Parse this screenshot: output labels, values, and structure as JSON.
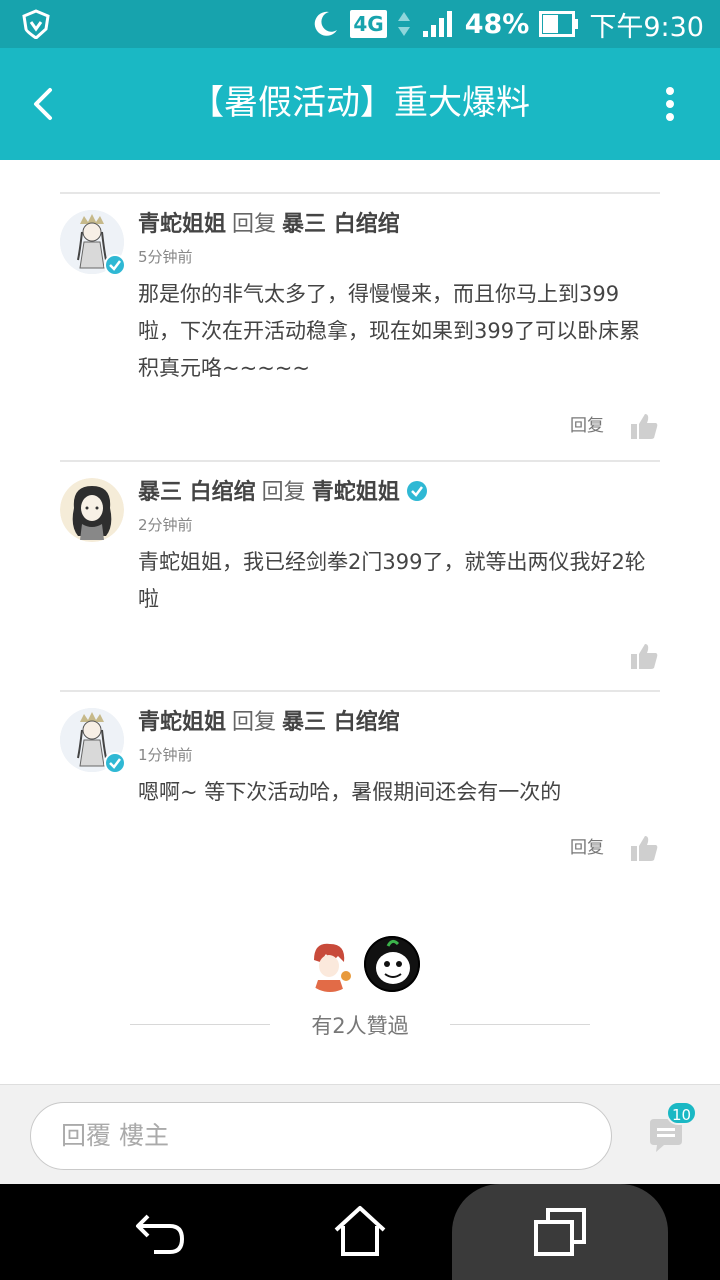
{
  "status_bar": {
    "network": "4G",
    "battery_pct": "48%",
    "time": "下午9:30"
  },
  "header": {
    "title": "【暑假活动】重大爆料"
  },
  "comments": [
    {
      "author": "青蛇姐姐",
      "reply_word": "回复",
      "target": "暴三 白绾绾",
      "time": "5分钟前",
      "text": "那是你的非气太多了，得慢慢来，而且你马上到399啦，下次在开活动稳拿，现在如果到399了可以卧床累积真元咯~~~~~",
      "reply_label": "回复"
    },
    {
      "author": "暴三 白绾绾",
      "reply_word": "回复",
      "target": "青蛇姐姐",
      "time": "2分钟前",
      "text": "青蛇姐姐，我已经剑拳2门399了，就等出两仪我好2轮啦"
    },
    {
      "author": "青蛇姐姐",
      "reply_word": "回复",
      "target": "暴三 白绾绾",
      "time": "1分钟前",
      "text": "嗯啊~ 等下次活动哈，暑假期间还会有一次的",
      "reply_label": "回复"
    }
  ],
  "likes": {
    "text": "有2人贊過"
  },
  "reply_bar": {
    "placeholder": "回覆  樓主",
    "comment_count": "10"
  },
  "colors": {
    "status_bar": "#17a3ad",
    "accent": "#1ab8c4",
    "verified": "#2fb8d4"
  }
}
